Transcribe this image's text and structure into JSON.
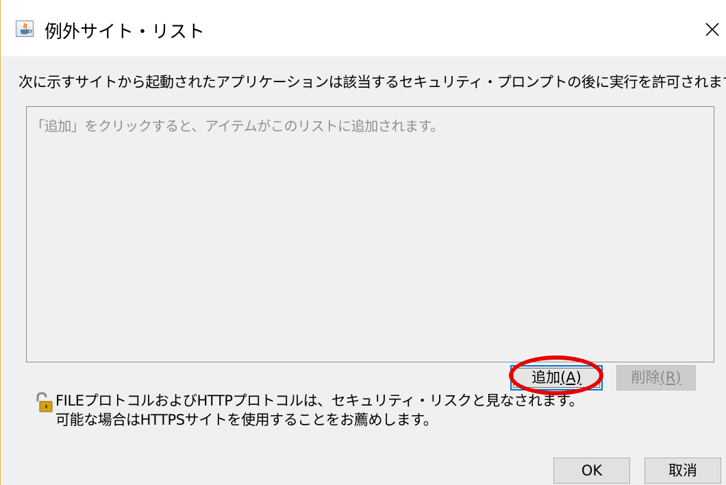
{
  "window": {
    "title": "例外サイト・リスト",
    "title_icon": "java-icon",
    "close_icon": "close-icon"
  },
  "description": "次に示すサイトから起動されたアプリケーションは該当するセキュリティ・プロンプトの後に実行を許可されます。",
  "site_list": {
    "placeholder": "「追加」をクリックすると、アイテムがこのリストに追加されます。",
    "items": []
  },
  "list_buttons": {
    "add": {
      "label": "追加",
      "mnemonic": "(A)",
      "focused": true,
      "highlighted": true,
      "highlight_color": "#e60000"
    },
    "remove": {
      "label": "削除",
      "mnemonic": "(R)",
      "enabled": false
    }
  },
  "warning": {
    "icon": "unlocked-padlock-icon",
    "line1": "FILEプロトコルおよびHTTPプロトコルは、セキュリティ・リスクと見なされます。",
    "line2": "可能な場合はHTTPSサイトを使用することをお薦めします。"
  },
  "dialog_buttons": {
    "ok": "OK",
    "cancel": "取消"
  },
  "colors": {
    "focus_border": "#0078d7",
    "annotation_ring": "#e60000",
    "placeholder_text": "#8f8f8f"
  }
}
